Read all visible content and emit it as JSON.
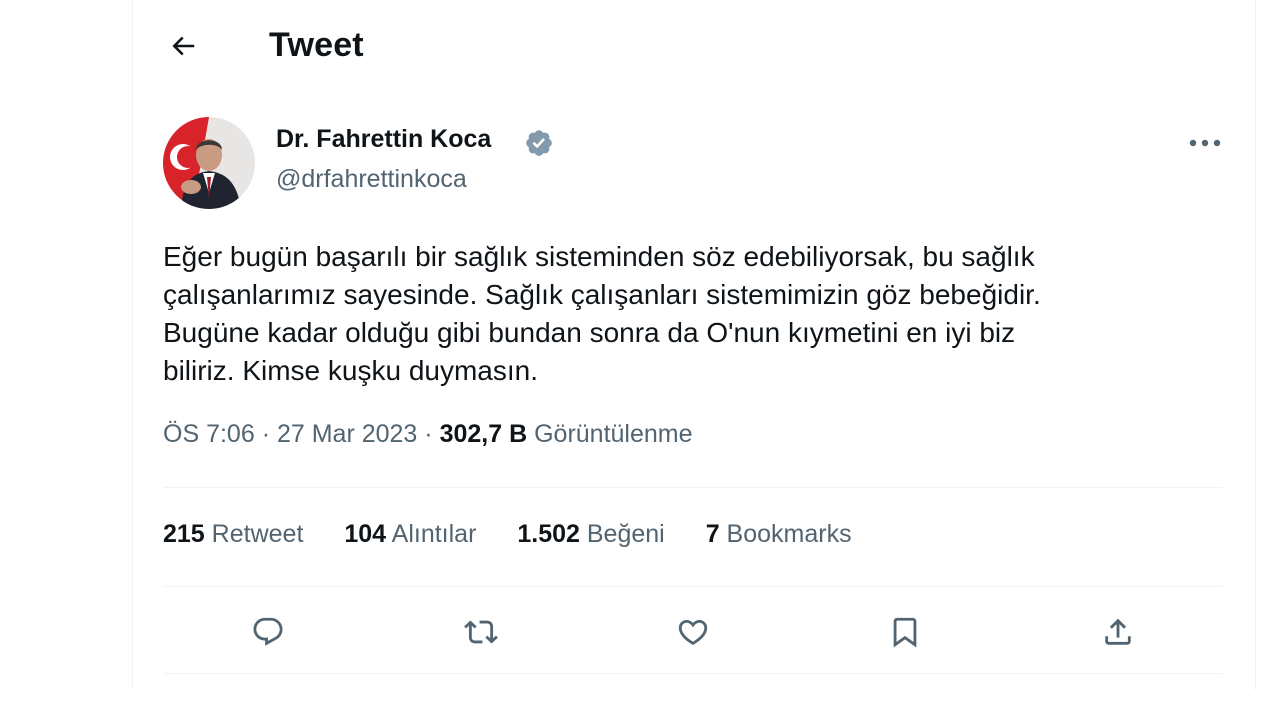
{
  "header": {
    "title": "Tweet",
    "back_icon": "arrow-left-icon"
  },
  "author": {
    "display_name": "Dr. Fahrettin Koca",
    "handle": "@drfahrettinkoca",
    "verified_color": "#829aab"
  },
  "tweet": {
    "lines": [
      "Eğer bugün başarılı bir sağlık sisteminden söz edebiliyorsak, bu sağlık",
      "çalışanlarımız sayesinde. Sağlık çalışanları sistemimizin göz bebeğidir.",
      "Bugüne kadar olduğu gibi bundan sonra da O'nun kıymetini en iyi biz",
      "biliriz. Kimse kuşku duymasın."
    ],
    "time": "ÖS 7:06",
    "date": "27 Mar 2023",
    "views_count": "302,7 B",
    "views_label": "Görüntülenme",
    "separator": "·"
  },
  "stats": {
    "retweets": {
      "count": "215",
      "label": "Retweet"
    },
    "quotes": {
      "count": "104",
      "label": "Alıntılar"
    },
    "likes": {
      "count": "1.502",
      "label": "Beğeni"
    },
    "bookmarks": {
      "count": "7",
      "label": "Bookmarks"
    }
  },
  "actions": [
    "reply-icon",
    "retweet-icon",
    "like-icon",
    "bookmark-icon",
    "share-icon"
  ],
  "colors": {
    "text": "#0f1419",
    "secondary": "#536471",
    "divider": "#eff3f4"
  }
}
